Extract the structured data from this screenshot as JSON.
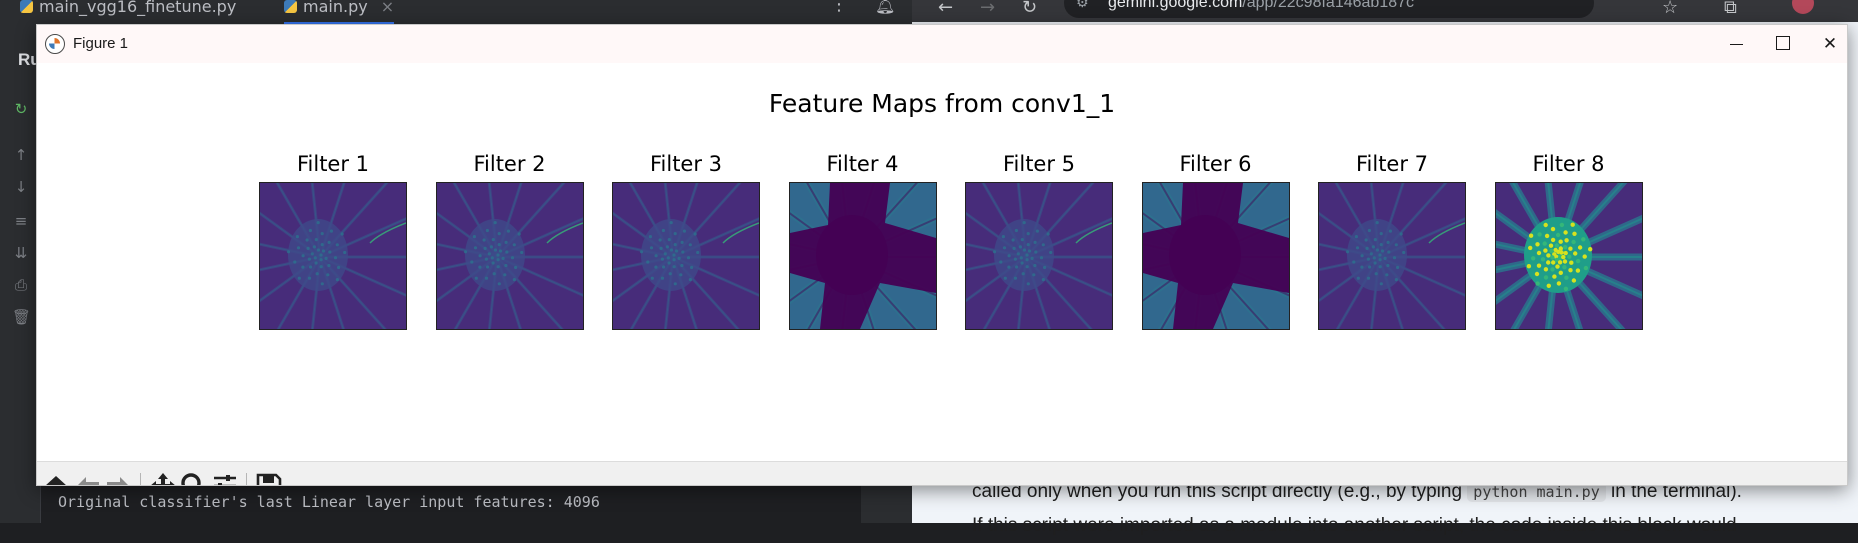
{
  "ide": {
    "tabs": [
      {
        "label": "main_vgg16_finetune.py",
        "active": false
      },
      {
        "label": "main.py",
        "active": true
      }
    ],
    "run_label": "Ru",
    "console_line": "Original classifier's last Linear layer input features: 4096"
  },
  "browser": {
    "url_host": "gemini.google.com",
    "url_path": "/app/22c98fa146ab187c",
    "content_line1_a": "called only when you run this script directly (e.g., by typing ",
    "content_code": "python main.py",
    "content_line1_b": " in the terminal).",
    "content_line2": "If this script were imported as a module into another script, the code inside this block would"
  },
  "figure_window": {
    "title": "Figure 1",
    "suptitle": "Feature Maps from conv1_1",
    "panels": [
      {
        "title": "Filter 1",
        "style": "emboss"
      },
      {
        "title": "Filter 2",
        "style": "emboss"
      },
      {
        "title": "Filter 3",
        "style": "emboss"
      },
      {
        "title": "Filter 4",
        "style": "dark-center"
      },
      {
        "title": "Filter 5",
        "style": "emboss"
      },
      {
        "title": "Filter 6",
        "style": "dark-center"
      },
      {
        "title": "Filter 7",
        "style": "emboss"
      },
      {
        "title": "Filter 8",
        "style": "bright-center"
      }
    ],
    "colors": {
      "viridis_dark": "#440154",
      "viridis_purple": "#472c7a",
      "viridis_teal": "#2a788e",
      "viridis_green": "#35b779",
      "viridis_yellow": "#d6e21f"
    },
    "toolbar": [
      {
        "name": "home-icon",
        "label": "Home"
      },
      {
        "name": "back-arrow-icon",
        "label": "Back"
      },
      {
        "name": "forward-arrow-icon",
        "label": "Forward"
      },
      {
        "name": "pan-icon",
        "label": "Pan"
      },
      {
        "name": "zoom-icon",
        "label": "Zoom"
      },
      {
        "name": "configure-subplots-icon",
        "label": "Configure subplots"
      },
      {
        "name": "save-icon",
        "label": "Save"
      }
    ]
  }
}
